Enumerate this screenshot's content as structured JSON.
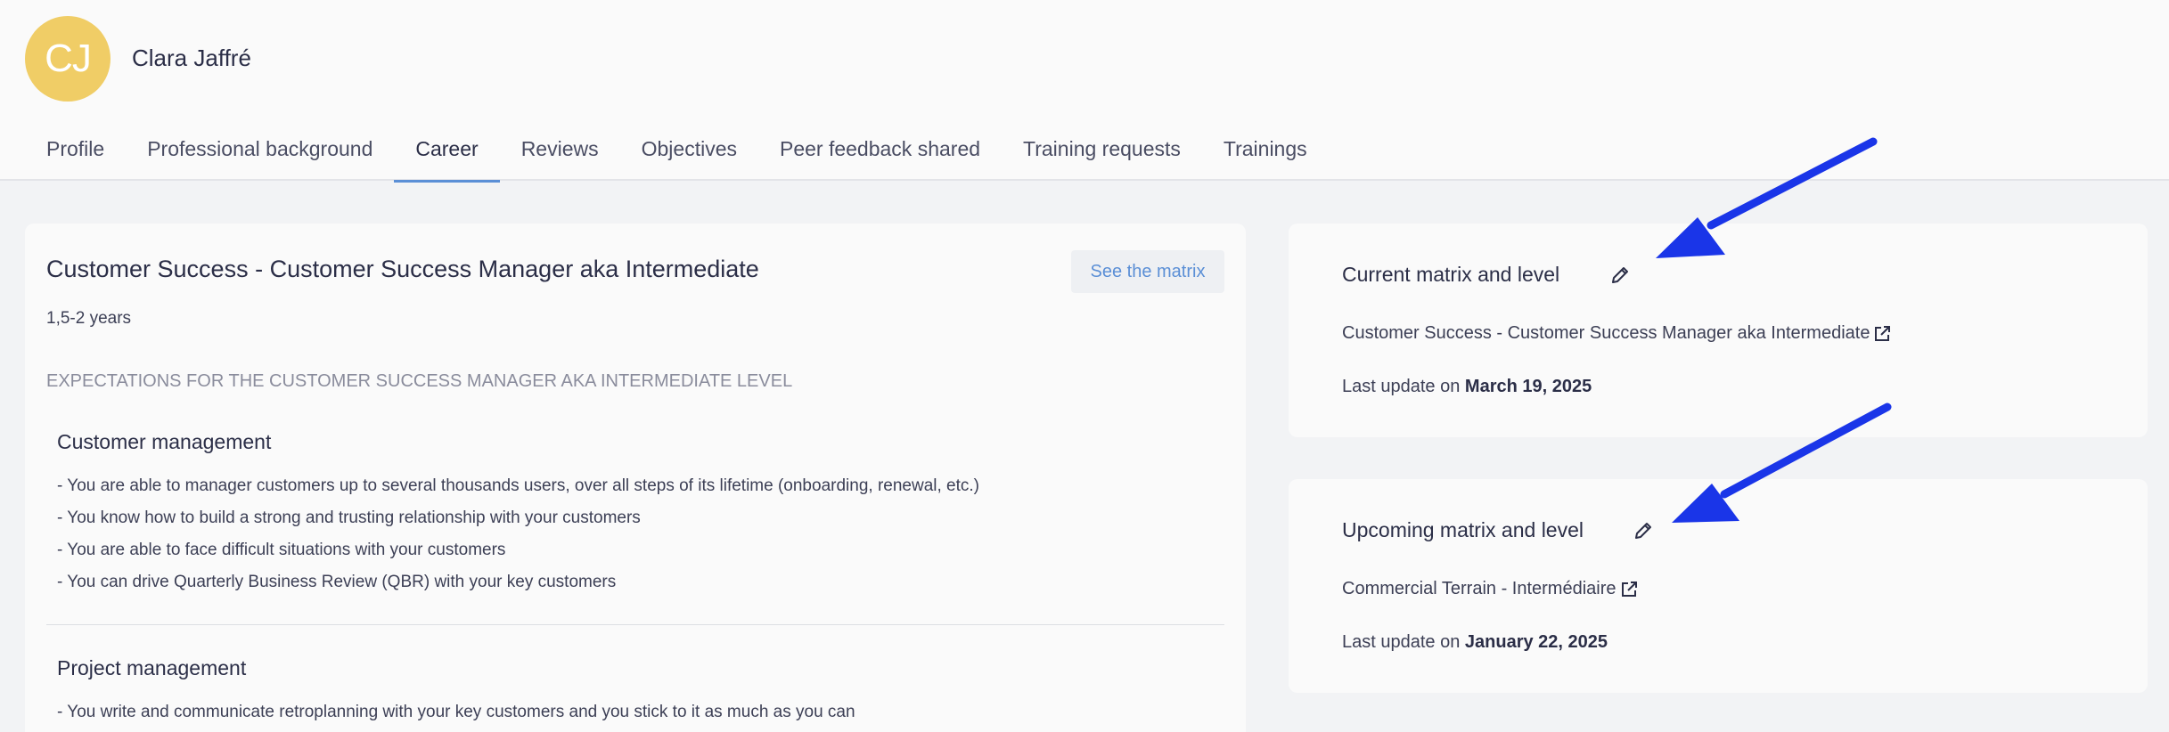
{
  "user": {
    "initials": "CJ",
    "name": "Clara Jaffré",
    "avatar_color": "#f0cd66"
  },
  "tabs": [
    {
      "label": "Profile"
    },
    {
      "label": "Professional background"
    },
    {
      "label": "Career"
    },
    {
      "label": "Reviews"
    },
    {
      "label": "Objectives"
    },
    {
      "label": "Peer feedback shared"
    },
    {
      "label": "Training requests"
    },
    {
      "label": "Trainings"
    }
  ],
  "active_tab": "Career",
  "career": {
    "title": "Customer Success - Customer Success Manager aka Intermediate",
    "see_matrix": "See the matrix",
    "duration": "1,5-2 years",
    "expectations_title": "EXPECTATIONS FOR THE CUSTOMER SUCCESS MANAGER AKA INTERMEDIATE LEVEL",
    "sections": [
      {
        "title": "Customer management",
        "items": [
          "- You are able to manager customers up to several thousands users, over all steps of its lifetime (onboarding, renewal, etc.)",
          "- You know how to build a strong and trusting relationship with your customers",
          "- You are able to face difficult situations with your customers",
          "- You can drive Quarterly Business Review (QBR) with your key customers"
        ]
      },
      {
        "title": "Project management",
        "items": [
          "- You write and communicate retroplanning with your key customers and you stick to it as much as you can"
        ]
      }
    ]
  },
  "current": {
    "title": "Current matrix and level",
    "value": "Customer Success - Customer Success Manager aka Intermediate",
    "update_prefix": "Last update on",
    "update_date": "March 19, 2025"
  },
  "upcoming": {
    "title": "Upcoming matrix and level",
    "value": "Commercial Terrain - Intermédiaire",
    "update_prefix": "Last update on",
    "update_date": "January 22, 2025"
  },
  "colors": {
    "accent": "#5b8fd6",
    "annotation_arrow": "#1a35e8"
  }
}
